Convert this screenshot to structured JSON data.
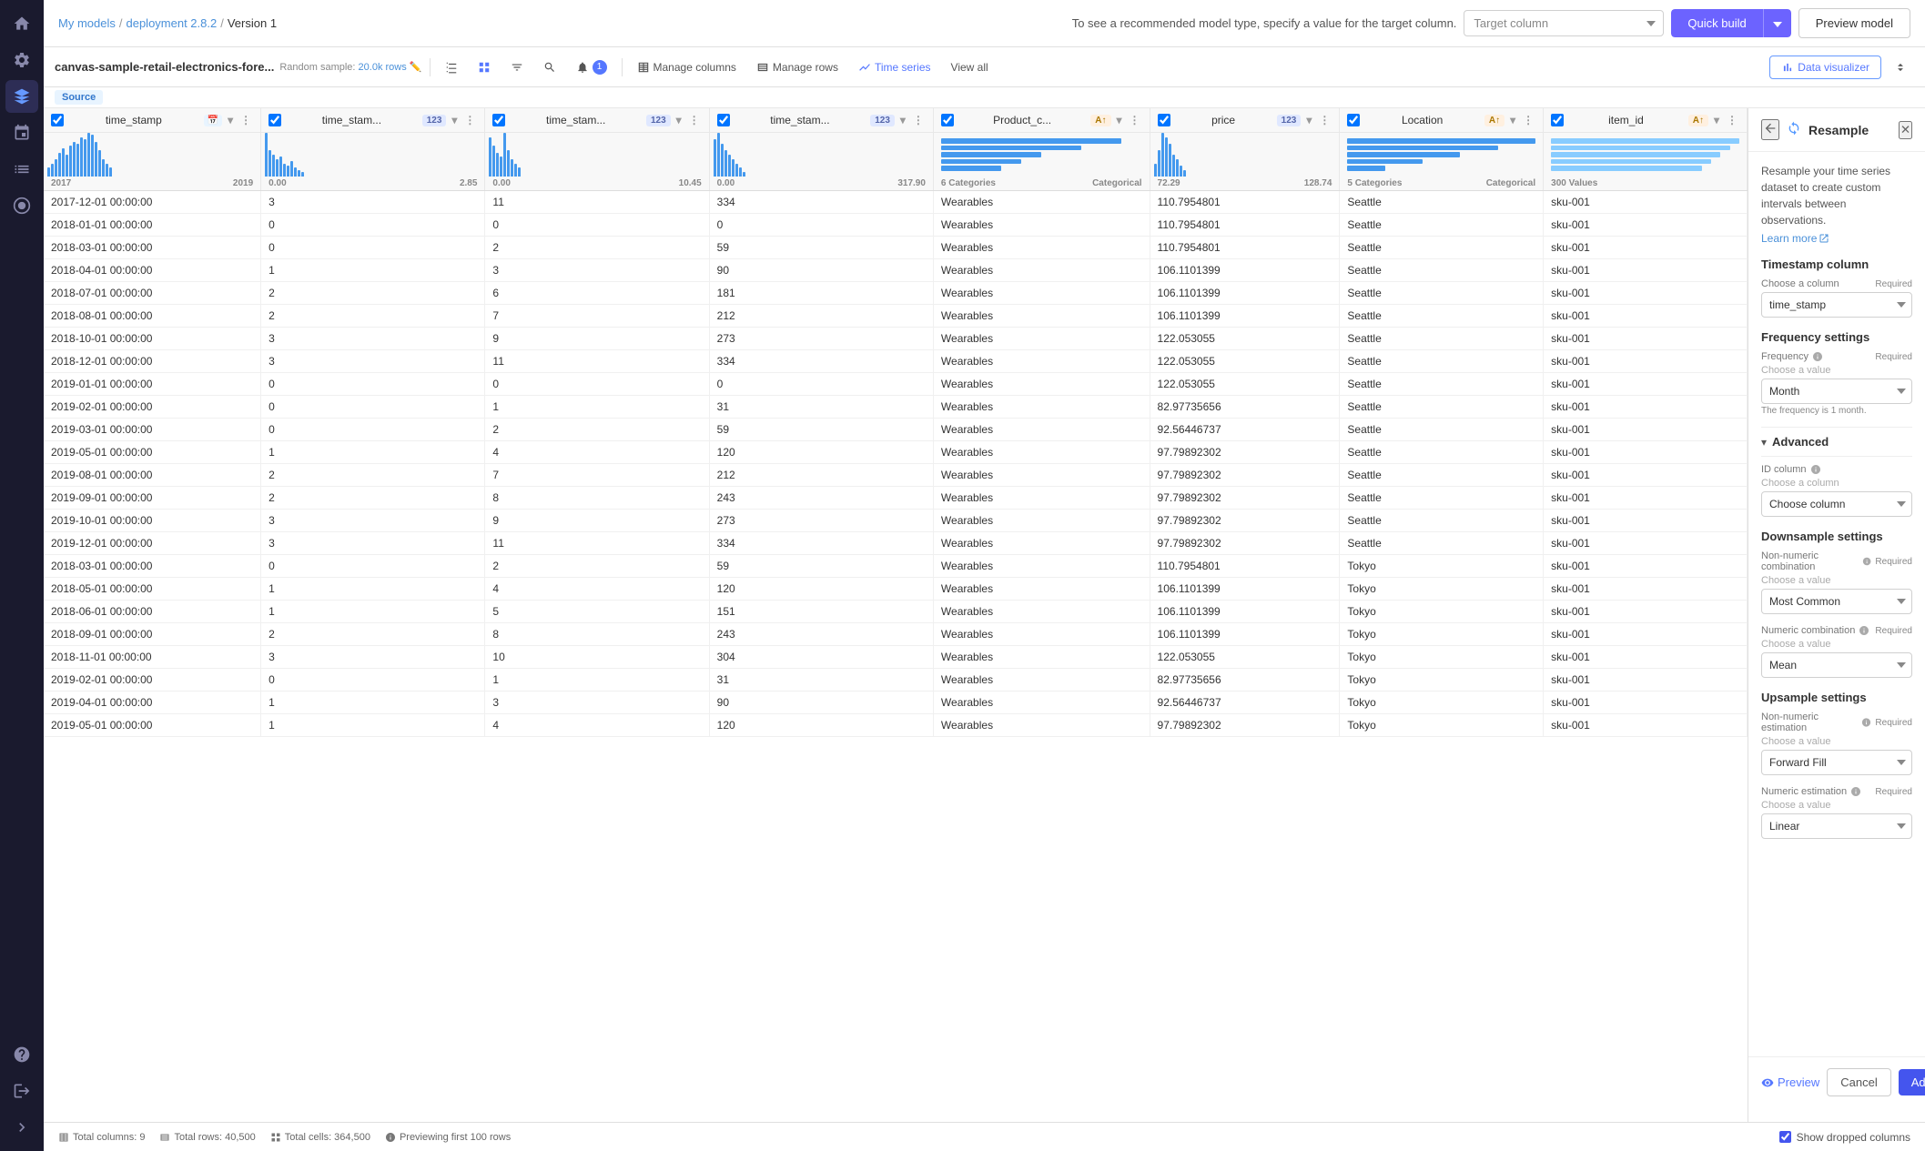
{
  "breadcrumb": {
    "my_models": "My models",
    "deployment": "deployment 2.8.2",
    "version": "Version 1"
  },
  "topbar": {
    "hint": "To see a recommended model type, specify a value for the target column.",
    "target_placeholder": "Target column",
    "quick_build": "Quick build",
    "preview_model": "Preview model"
  },
  "toolbar": {
    "dataset_name": "canvas-sample-retail-electronics-fore...",
    "sample_info": "Random sample:",
    "rows_count": "20.0k rows",
    "manage_columns": "Manage columns",
    "manage_rows": "Manage rows",
    "time_series": "Time series",
    "view_all": "View all",
    "data_visualizer": "Data visualizer",
    "source_tag": "Source"
  },
  "columns": [
    {
      "name": "time_stamp",
      "type": "date",
      "type_label": "📅",
      "range_min": "2017",
      "range_max": "2019",
      "chart_type": "bar"
    },
    {
      "name": "time_stam...",
      "type": "123",
      "type_label": "123",
      "range_min": "0.00",
      "range_max": "2.85",
      "chart_type": "bar"
    },
    {
      "name": "time_stam...",
      "type": "123",
      "type_label": "123",
      "range_min": "0.00",
      "range_max": "10.45",
      "chart_type": "bar"
    },
    {
      "name": "time_stam...",
      "type": "123",
      "type_label": "123",
      "range_min": "0.00",
      "range_max": "317.90",
      "chart_type": "bar"
    },
    {
      "name": "Product_c...",
      "type": "A↑",
      "type_label": "A",
      "range_min": "6 Categories",
      "range_max": "Categorical",
      "chart_type": "cat"
    },
    {
      "name": "price",
      "type": "123",
      "type_label": "123",
      "range_min": "72.29",
      "range_max": "128.74",
      "chart_type": "bar"
    },
    {
      "name": "Location",
      "type": "A↑",
      "type_label": "A",
      "range_min": "5 Categories",
      "range_max": "Categorical",
      "chart_type": "cat"
    },
    {
      "name": "item_id",
      "type": "A↑",
      "type_label": "A",
      "range_min": "300 Values",
      "range_max": "",
      "chart_type": "cat"
    }
  ],
  "rows": [
    [
      "2017-12-01 00:00:00",
      "3",
      "11",
      "334",
      "Wearables",
      "110.7954801",
      "Seattle",
      "sku-001"
    ],
    [
      "2018-01-01 00:00:00",
      "0",
      "0",
      "0",
      "Wearables",
      "110.7954801",
      "Seattle",
      "sku-001"
    ],
    [
      "2018-03-01 00:00:00",
      "0",
      "2",
      "59",
      "Wearables",
      "110.7954801",
      "Seattle",
      "sku-001"
    ],
    [
      "2018-04-01 00:00:00",
      "1",
      "3",
      "90",
      "Wearables",
      "106.1101399",
      "Seattle",
      "sku-001"
    ],
    [
      "2018-07-01 00:00:00",
      "2",
      "6",
      "181",
      "Wearables",
      "106.1101399",
      "Seattle",
      "sku-001"
    ],
    [
      "2018-08-01 00:00:00",
      "2",
      "7",
      "212",
      "Wearables",
      "106.1101399",
      "Seattle",
      "sku-001"
    ],
    [
      "2018-10-01 00:00:00",
      "3",
      "9",
      "273",
      "Wearables",
      "122.053055",
      "Seattle",
      "sku-001"
    ],
    [
      "2018-12-01 00:00:00",
      "3",
      "11",
      "334",
      "Wearables",
      "122.053055",
      "Seattle",
      "sku-001"
    ],
    [
      "2019-01-01 00:00:00",
      "0",
      "0",
      "0",
      "Wearables",
      "122.053055",
      "Seattle",
      "sku-001"
    ],
    [
      "2019-02-01 00:00:00",
      "0",
      "1",
      "31",
      "Wearables",
      "82.97735656",
      "Seattle",
      "sku-001"
    ],
    [
      "2019-03-01 00:00:00",
      "0",
      "2",
      "59",
      "Wearables",
      "92.56446737",
      "Seattle",
      "sku-001"
    ],
    [
      "2019-05-01 00:00:00",
      "1",
      "4",
      "120",
      "Wearables",
      "97.79892302",
      "Seattle",
      "sku-001"
    ],
    [
      "2019-08-01 00:00:00",
      "2",
      "7",
      "212",
      "Wearables",
      "97.79892302",
      "Seattle",
      "sku-001"
    ],
    [
      "2019-09-01 00:00:00",
      "2",
      "8",
      "243",
      "Wearables",
      "97.79892302",
      "Seattle",
      "sku-001"
    ],
    [
      "2019-10-01 00:00:00",
      "3",
      "9",
      "273",
      "Wearables",
      "97.79892302",
      "Seattle",
      "sku-001"
    ],
    [
      "2019-12-01 00:00:00",
      "3",
      "11",
      "334",
      "Wearables",
      "97.79892302",
      "Seattle",
      "sku-001"
    ],
    [
      "2018-03-01 00:00:00",
      "0",
      "2",
      "59",
      "Wearables",
      "110.7954801",
      "Tokyo",
      "sku-001"
    ],
    [
      "2018-05-01 00:00:00",
      "1",
      "4",
      "120",
      "Wearables",
      "106.1101399",
      "Tokyo",
      "sku-001"
    ],
    [
      "2018-06-01 00:00:00",
      "1",
      "5",
      "151",
      "Wearables",
      "106.1101399",
      "Tokyo",
      "sku-001"
    ],
    [
      "2018-09-01 00:00:00",
      "2",
      "8",
      "243",
      "Wearables",
      "106.1101399",
      "Tokyo",
      "sku-001"
    ],
    [
      "2018-11-01 00:00:00",
      "3",
      "10",
      "304",
      "Wearables",
      "122.053055",
      "Tokyo",
      "sku-001"
    ],
    [
      "2019-02-01 00:00:00",
      "0",
      "1",
      "31",
      "Wearables",
      "82.97735656",
      "Tokyo",
      "sku-001"
    ],
    [
      "2019-04-01 00:00:00",
      "1",
      "3",
      "90",
      "Wearables",
      "92.56446737",
      "Tokyo",
      "sku-001"
    ],
    [
      "2019-05-01 00:00:00",
      "1",
      "4",
      "120",
      "Wearables",
      "97.79892302",
      "Tokyo",
      "sku-001"
    ]
  ],
  "resample_panel": {
    "title": "Resample",
    "description": "Resample your time series dataset to create custom intervals between observations.",
    "learn_more": "Learn more",
    "timestamp_section": "Timestamp column",
    "timestamp_label": "Choose a column",
    "timestamp_required": "Required",
    "timestamp_value": "time_stamp",
    "frequency_section": "Frequency settings",
    "frequency_label": "Frequency",
    "frequency_required": "Required",
    "frequency_choose": "Choose a value",
    "frequency_value": "Month",
    "frequency_hint": "The frequency is 1 month.",
    "advanced_label": "Advanced",
    "id_column_label": "ID column",
    "id_column_choose": "Choose a column",
    "downsample_title": "Downsample settings",
    "non_numeric_label": "Non-numeric combination",
    "non_numeric_required": "Required",
    "non_numeric_choose": "Choose a value",
    "non_numeric_value": "Most Common",
    "numeric_label": "Numeric combination",
    "numeric_required": "Required",
    "numeric_choose": "Choose a value",
    "numeric_value": "Mean",
    "upsample_title": "Upsample settings",
    "non_numeric_est_label": "Non-numeric estimation",
    "non_numeric_est_required": "Required",
    "non_numeric_est_choose": "Choose a value",
    "non_numeric_est_value": "Forward Fill",
    "numeric_est_label": "Numeric estimation",
    "numeric_est_required": "Required",
    "numeric_est_choose": "Choose a value",
    "numeric_est_value": "Linear",
    "choose_column": "Choose column",
    "preview_btn": "Preview",
    "cancel_btn": "Cancel",
    "add_btn": "Add"
  },
  "status_bar": {
    "total_columns": "Total columns: 9",
    "total_rows": "Total rows: 40,500",
    "total_cells": "Total cells: 364,500",
    "previewing": "Previewing first 100 rows",
    "show_dropped": "Show dropped columns"
  }
}
